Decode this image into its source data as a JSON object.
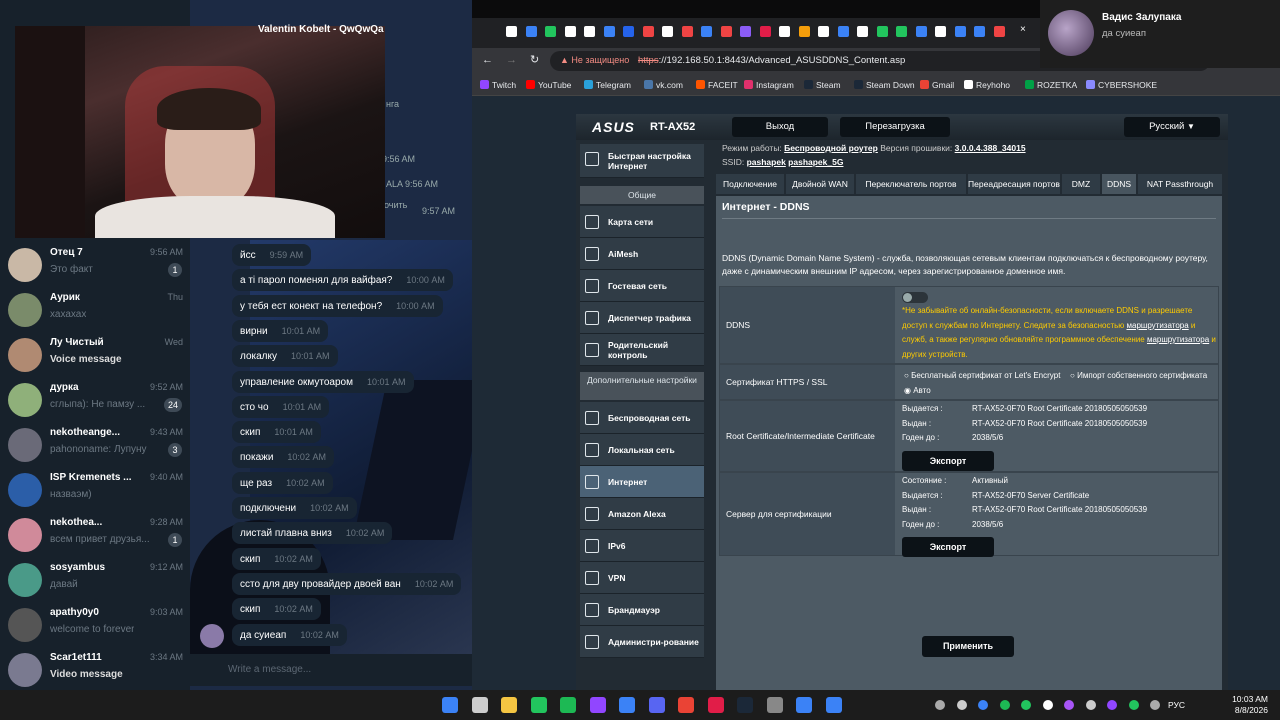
{
  "telegram": {
    "chats": [
      {
        "name": "Отец 7",
        "time": "9:56 AM",
        "preview": "Это факт",
        "badge": "1"
      },
      {
        "name": "Аурик",
        "time": "Thu",
        "preview": "хахахах",
        "badge": ""
      },
      {
        "name": "Лу Чистый",
        "time": "Wed",
        "preview": "Voice message",
        "badge": ""
      },
      {
        "name": "дурка",
        "time": "9:52 AM",
        "preview": "сглыпа): Не памзу ...",
        "badge": "24"
      },
      {
        "name": "nekotheange...",
        "time": "9:43 AM",
        "preview": "pahononame: Лупуну",
        "badge": "3"
      },
      {
        "name": "ISP Kremenets ...",
        "time": "9:40 AM",
        "preview": "назваэм)",
        "badge": ""
      },
      {
        "name": "nekothea...",
        "time": "9:28 AM",
        "preview": "всем привет друзья...",
        "badge": "1"
      },
      {
        "name": "sosyambus",
        "time": "9:12 AM",
        "preview": "давай",
        "badge": ""
      },
      {
        "name": "apathy0y0",
        "time": "9:03 AM",
        "preview": "welcome to forever",
        "badge": ""
      },
      {
        "name": "Scar1et111",
        "time": "3:34 AM",
        "preview": "Video message",
        "badge": ""
      }
    ],
    "messages": [
      {
        "text": "йсс",
        "time": "9:59 AM"
      },
      {
        "text": "а ті парол поменял для вайфая?",
        "time": "10:00 AM"
      },
      {
        "text": "у тебя ест конект на телефон?",
        "time": "10:00 AM"
      },
      {
        "text": "вирни",
        "time": "10:01 AM"
      },
      {
        "text": "локалку",
        "time": "10:01 AM"
      },
      {
        "text": "управление окмутоаром",
        "time": "10:01 AM"
      },
      {
        "text": "сто чо",
        "time": "10:01 AM"
      },
      {
        "text": "скип",
        "time": "10:01 AM"
      },
      {
        "text": "покажи",
        "time": "10:02 AM"
      },
      {
        "text": "ще раз",
        "time": "10:02 AM"
      },
      {
        "text": "подключени",
        "time": "10:02 AM"
      },
      {
        "text": "листай плавна вниз",
        "time": "10:02 AM"
      },
      {
        "text": "скип",
        "time": "10:02 AM"
      },
      {
        "text": "ссто для дву провайдер двоей ван",
        "time": "10:02 AM"
      },
      {
        "text": "скип",
        "time": "10:02 AM"
      },
      {
        "text": "да суиеап",
        "time": "10:02 AM"
      }
    ],
    "top_chat_title": "Valentin Kobelt - QwQwQa",
    "peek_texts": [
      "нга",
      "9:56 AM",
      "ALA 9:56 AM",
      "очить",
      "9:57 AM"
    ],
    "composer_placeholder": "Write a message..."
  },
  "chrome": {
    "not_secure": "Не защищено",
    "url_scheme": "https",
    "url_rest": "://192.168.50.1:8443/Advanced_ASUSDDNS_Content.asp",
    "bookmarks": [
      "Twitch",
      "YouTube",
      "Telegram",
      "vk.com",
      "FACEIT",
      "Instagram",
      "Steam",
      "Steam Down",
      "Gmail",
      "Reyhoho",
      "ROZETKA",
      "CYBERSHOKE"
    ]
  },
  "router": {
    "brand": "ASUS",
    "model": "RT-AX52",
    "logout": "Выход",
    "reboot": "Перезагрузка",
    "language": "Русский",
    "mode_label": "Режим работы:",
    "mode_value": "Беспроводной роутер",
    "fw_label": "Версия прошивки:",
    "fw_value": "3.0.0.4.388_34015",
    "ssid_label": "SSID:",
    "ssid1": "pashapek",
    "ssid2": "pashapek_5G",
    "sidebar": {
      "quick": "Быстрая настройка Интернет",
      "general_head": "Общие",
      "general": [
        "Карта сети",
        "AiMesh",
        "Гостевая сеть",
        "Диспетчер трафика",
        "Родительский контроль"
      ],
      "advanced_head": "Дополнительные настройки",
      "advanced": [
        "Беспроводная сеть",
        "Локальная сеть",
        "Интернет",
        "Amazon Alexa",
        "IPv6",
        "VPN",
        "Брандмауэр",
        "Администри-рование"
      ]
    },
    "tabs": [
      "Подключение",
      "Двойной WAN",
      "Переключатель портов",
      "Переадресация портов",
      "DMZ",
      "DDNS",
      "NAT Passthrough"
    ],
    "page_title": "Интернет - DDNS",
    "description": "DDNS (Dynamic Domain Name System) - служба, позволяющая сетевым клиентам подключаться к беспроводному роутеру, даже с динамическим внешним IP адресом, через зарегистрированное доменное имя.",
    "ddns_label": "DDNS",
    "ddns_warning_1": "*Не забывайте об онлайн-безопасности, если включаете DDNS и разрешаете доступ к службам по Интернету. Следите за безопасностью ",
    "ddns_warning_link1": "маршрутизатора",
    "ddns_warning_2": " и служб, а также регулярно обновляйте программное обеспечение ",
    "ddns_warning_link2": "маршрутизатора",
    "ddns_warning_3": " и других устройств.",
    "https_label": "Сертификат HTTPS / SSL",
    "https_opt1": "Бесплатный сертификат от Let's Encrypt",
    "https_opt2": "Импорт собственного сертификата",
    "https_opt3": "Авто",
    "root_label": "Root Certificate/Intermediate Certificate",
    "root_kv": [
      {
        "k": "Выдается :",
        "v": "RT-AX52-0F70 Root Certificate 20180505050539"
      },
      {
        "k": "Выдан :",
        "v": "RT-AX52-0F70 Root Certificate 20180505050539"
      },
      {
        "k": "Годен до :",
        "v": "2038/5/6"
      }
    ],
    "server_label": "Сервер для сертификации",
    "server_kv": [
      {
        "k": "Состояние :",
        "v": "Активный"
      },
      {
        "k": "Выдается :",
        "v": "RT-AX52-0F70 Server Certificate"
      },
      {
        "k": "Выдан :",
        "v": "RT-AX52-0F70 Root Certificate 20180505050539"
      },
      {
        "k": "Годен до :",
        "v": "2038/5/6"
      }
    ],
    "export": "Экспорт",
    "apply": "Применить"
  },
  "notification": {
    "name": "Вадис Залупака",
    "text": "да суиеап"
  },
  "taskbar": {
    "lang": "РУС",
    "time": "10:03 AM",
    "date": "8/8/2026"
  }
}
